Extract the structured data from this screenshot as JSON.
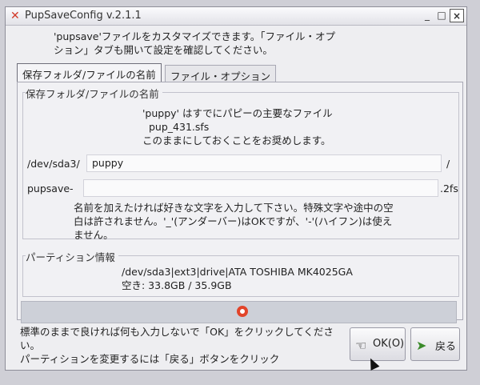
{
  "window": {
    "title": "PupSaveConfig v.2.1.1",
    "controls": {
      "minimize": "_",
      "maximize": "□",
      "close": "×"
    }
  },
  "intro": {
    "line1": "'pupsave'ファイルをカスタマイズできます。「ファイル・オプ",
    "line2": "ション」タブも開いて設定を確認してください。"
  },
  "tabs": [
    {
      "label": "保存フォルダ/ファイルの名前",
      "active": true
    },
    {
      "label": "ファイル・オプション",
      "active": false
    }
  ],
  "save_group": {
    "title": "保存フォルダ/ファイルの名前",
    "info_line1": "'puppy' はすでにパピーの主要なファイル",
    "info_line2": "pup_431.sfs",
    "info_line3": "このままにしておくことをお奨めします。",
    "folder_prefix": "/dev/sda3/",
    "folder_value": "puppy",
    "folder_suffix": "/",
    "file_prefix": "pupsave-",
    "file_value": "",
    "file_suffix": ".2fs",
    "help_line1": "名前を加えたければ好きな文字を入力して下さい。特殊文字や途中の空",
    "help_line2": "白は許されません。'_'(アンダーバー)はOKですが、'-'(ハイフン)は使え",
    "help_line3": "ません。"
  },
  "partition_group": {
    "title": "パーティション情報",
    "device": "/dev/sda3|ext3|drive|ATA TOSHIBA MK4025GA",
    "space": "空き: 33.8GB / 35.9GB"
  },
  "footer": {
    "line1": "標準のままで良ければ何も入力しないで「OK」をクリックしてくださ",
    "line2": "い。",
    "line3": "パーティションを変更するには「戻る」ボタンをクリック"
  },
  "buttons": {
    "ok": "OK(O)",
    "back": "戻る"
  },
  "icons": {
    "app": "x-close-icon",
    "help": "lifebuoy-icon",
    "ok": "hand-pointing-icon",
    "back": "back-arrow-icon"
  }
}
